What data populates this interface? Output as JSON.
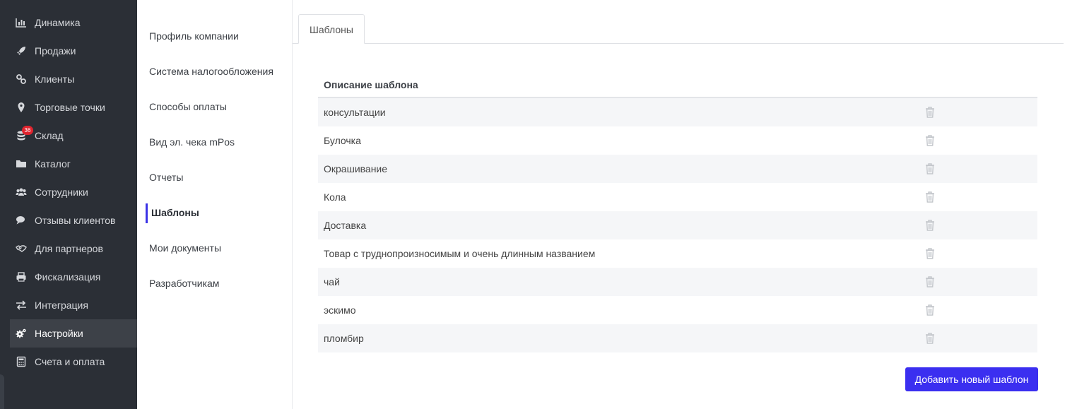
{
  "sidebar": {
    "items": [
      {
        "label": "Динамика",
        "icon": "bar-chart-icon"
      },
      {
        "label": "Продажи",
        "icon": "rocket-icon"
      },
      {
        "label": "Клиенты",
        "icon": "link-icon"
      },
      {
        "label": "Торговые точки",
        "icon": "map-pin-icon"
      },
      {
        "label": "Склад",
        "icon": "database-icon",
        "badge": "36"
      },
      {
        "label": "Каталог",
        "icon": "folder-icon"
      },
      {
        "label": "Сотрудники",
        "icon": "users-icon"
      },
      {
        "label": "Отзывы клиентов",
        "icon": "comments-icon"
      },
      {
        "label": "Для партнеров",
        "icon": "handshake-icon"
      },
      {
        "label": "Фискализация",
        "icon": "printer-icon"
      },
      {
        "label": "Интеграция",
        "icon": "exchange-icon"
      },
      {
        "label": "Настройки",
        "icon": "gears-icon",
        "active": true
      },
      {
        "label": "Счета и оплата",
        "icon": "calculator-icon"
      }
    ]
  },
  "submenu": {
    "items": [
      {
        "label": "Профиль компании"
      },
      {
        "label": "Система налогообложения"
      },
      {
        "label": "Способы оплаты"
      },
      {
        "label": "Вид эл. чека mPos"
      },
      {
        "label": "Отчеты"
      },
      {
        "label": "Шаблоны",
        "active": true
      },
      {
        "label": "Мои документы"
      },
      {
        "label": "Разработчикам"
      }
    ]
  },
  "main": {
    "tab_label": "Шаблоны",
    "table": {
      "header": "Описание шаблона",
      "rows": [
        "консультации",
        "Булочка",
        "Окрашивание",
        "Кола",
        "Доставка",
        "Товар с труднопроизносимым и очень длинным названием",
        "чай",
        "эскимо",
        "пломбир"
      ],
      "row_action_icon": "trash-icon"
    },
    "add_button_label": "Добавить новый шаблон"
  },
  "colors": {
    "sidebar_bg": "#2b2f36",
    "sidebar_active_bg": "#3d4148",
    "accent": "#3b2ff0",
    "badge": "#e0242e",
    "row_stripe": "#f5f6f8"
  }
}
